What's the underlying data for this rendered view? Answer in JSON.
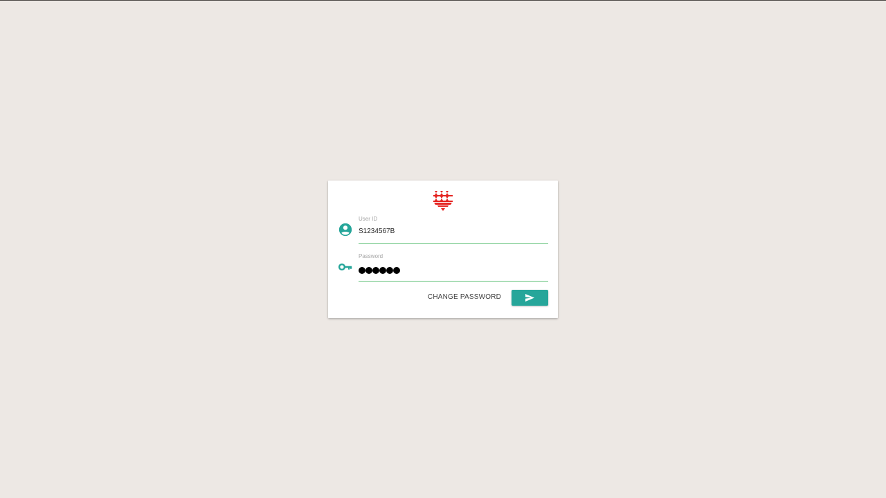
{
  "login": {
    "logo_icon": "red-layered-chevron-logo",
    "user_id": {
      "label": "User ID",
      "value": "S1234567B",
      "icon": "account-circle-icon"
    },
    "password": {
      "label": "Password",
      "masked_length": 6,
      "icon": "key-icon"
    },
    "change_password_label": "CHANGE PASSWORD",
    "submit_icon": "send-icon"
  },
  "colors": {
    "background": "#ede8e4",
    "accent": "#26a69a",
    "underline": "#5cbf75",
    "logo": "#e52421"
  }
}
